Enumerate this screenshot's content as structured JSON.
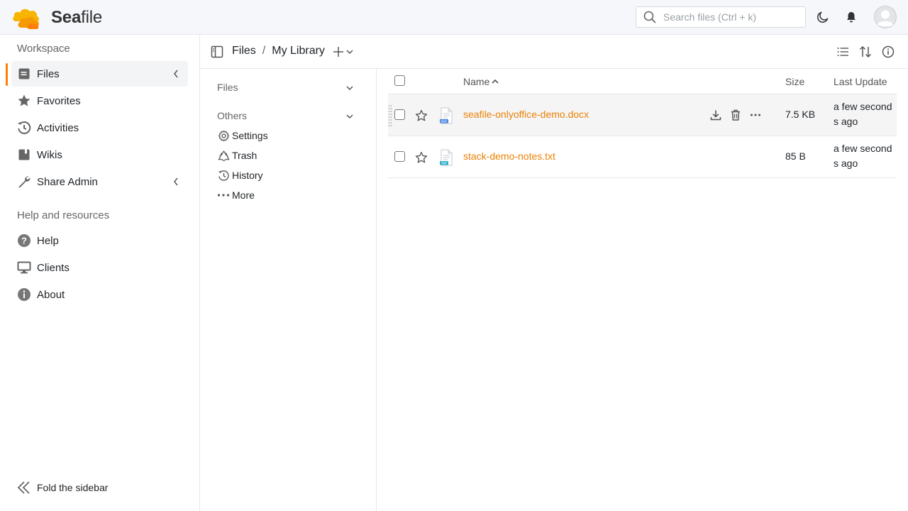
{
  "header": {
    "brand_sea": "Sea",
    "brand_file": "file",
    "search_placeholder": "Search files (Ctrl + k)"
  },
  "sidebar": {
    "workspace_heading": "Workspace",
    "items": [
      {
        "label": "Files",
        "icon": "files-icon"
      },
      {
        "label": "Favorites",
        "icon": "star-icon"
      },
      {
        "label": "Activities",
        "icon": "history-icon"
      },
      {
        "label": "Wikis",
        "icon": "wiki-icon"
      },
      {
        "label": "Share Admin",
        "icon": "wrench-icon"
      }
    ],
    "help_heading": "Help and resources",
    "help_items": [
      {
        "label": "Help",
        "icon": "question-icon"
      },
      {
        "label": "Clients",
        "icon": "monitor-icon"
      },
      {
        "label": "About",
        "icon": "info-icon"
      }
    ],
    "fold_label": "Fold the sidebar"
  },
  "path": {
    "root": "Files",
    "separator": "/",
    "current": "My Library"
  },
  "panel": {
    "files_heading": "Files",
    "others_heading": "Others",
    "items": [
      {
        "label": "Settings"
      },
      {
        "label": "Trash"
      },
      {
        "label": "History"
      },
      {
        "label": "More"
      }
    ]
  },
  "table": {
    "columns": {
      "name": "Name",
      "size": "Size",
      "last_update": "Last Update"
    },
    "rows": [
      {
        "name": "seafile-onlyoffice-demo.docx",
        "type_badge": "DOC",
        "size": "7.5 KB",
        "updated": "a few seconds ago"
      },
      {
        "name": "stack-demo-notes.txt",
        "type_badge": "TXT",
        "size": "85 B",
        "updated": "a few seconds ago"
      }
    ]
  },
  "colors": {
    "accent": "#ff8000",
    "link": "#eb8205",
    "doc_badge": "#3d7de0",
    "txt_badge": "#2ab0c5"
  }
}
